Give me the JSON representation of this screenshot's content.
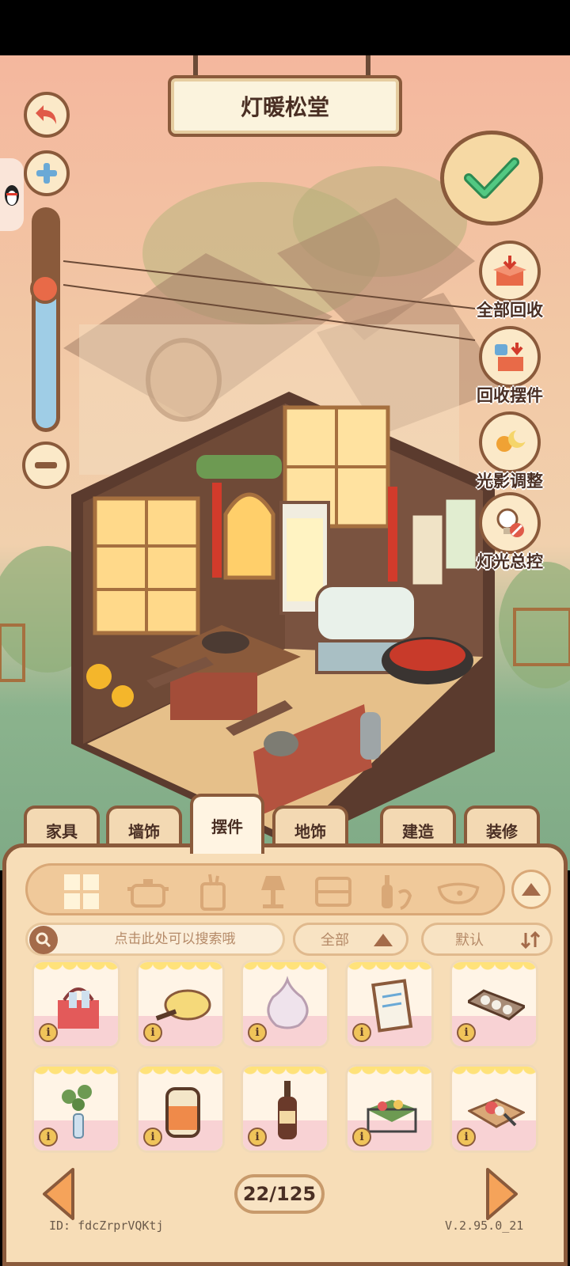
{
  "title": "灯暖松堂",
  "side_tools": [
    {
      "label": "全部回收",
      "icon": "box-recycle-icon"
    },
    {
      "label": "回收摆件",
      "icon": "cup-recycle-icon"
    },
    {
      "label": "光影调整",
      "icon": "sun-moon-icon"
    },
    {
      "label": "灯光总控",
      "icon": "bulb-off-icon"
    }
  ],
  "zoom_level": 0.65,
  "tabs": [
    {
      "label": "家具"
    },
    {
      "label": "墙饰"
    },
    {
      "label": "摆件",
      "active": true
    },
    {
      "label": "地饰"
    },
    {
      "label": "建造"
    },
    {
      "label": "装修"
    }
  ],
  "subcategories": [
    "grid-all-icon",
    "pot-icon",
    "cup-icon",
    "lamp-icon",
    "box-icon",
    "bottle-icon",
    "bowl-icon"
  ],
  "search": {
    "placeholder": "点击此处可以搜索哦"
  },
  "filters": {
    "category": "全部",
    "sort": "默认"
  },
  "items": [
    {
      "name": "basket-bottles-item"
    },
    {
      "name": "pan-item"
    },
    {
      "name": "garlic-item"
    },
    {
      "name": "clipboard-item"
    },
    {
      "name": "egg-tray-item"
    },
    {
      "name": "plant-vase-item"
    },
    {
      "name": "jar-item"
    },
    {
      "name": "bottle-item"
    },
    {
      "name": "vegetable-basket-item"
    },
    {
      "name": "cutting-board-item"
    }
  ],
  "pagination": {
    "label": "22/125"
  },
  "footer": {
    "id": "ID:  fdcZrprVQKtj",
    "version": "V.2.95.0_21"
  },
  "colors": {
    "accent": "#8a5a3b",
    "panel": "#f7ddb7",
    "confirm": "#3fae6e",
    "red": "#e05a49"
  }
}
